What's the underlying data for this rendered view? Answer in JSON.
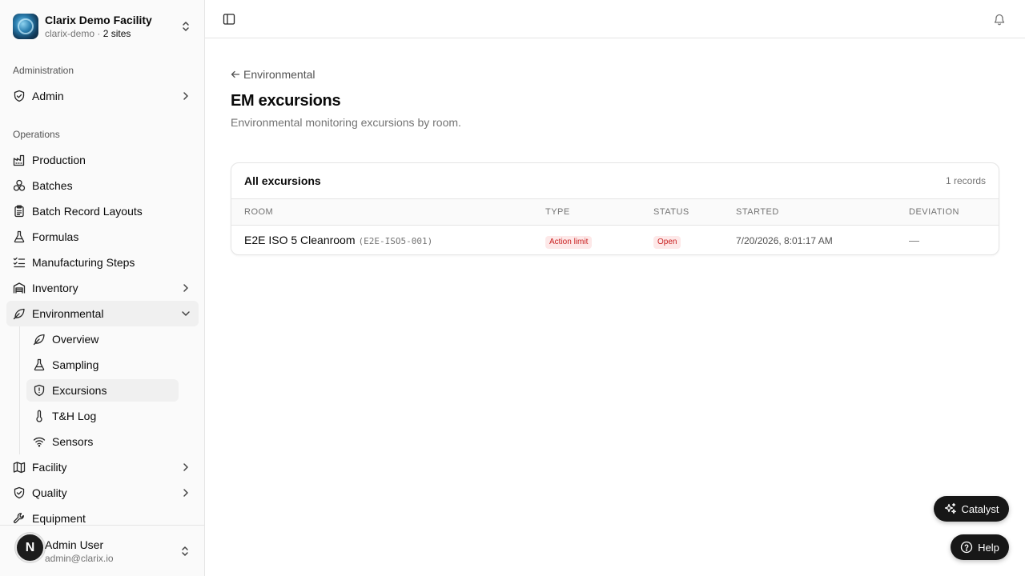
{
  "org": {
    "name": "Clarix Demo Facility",
    "slug": "clarix-demo",
    "sep": " · ",
    "sites": "2 sites"
  },
  "sidebar": {
    "section_admin": "Administration",
    "admin": "Admin",
    "section_ops": "Operations",
    "items": {
      "production": "Production",
      "batches": "Batches",
      "batch_record_layouts": "Batch Record Layouts",
      "formulas": "Formulas",
      "manufacturing_steps": "Manufacturing Steps",
      "inventory": "Inventory",
      "environmental": "Environmental",
      "facility": "Facility",
      "quality": "Quality",
      "equipment": "Equipment"
    },
    "environmental_sub": {
      "overview": "Overview",
      "sampling": "Sampling",
      "excursions": "Excursions",
      "th_log": "T&H Log",
      "sensors": "Sensors"
    }
  },
  "user": {
    "initial": "N",
    "name": "Admin User",
    "email": "admin@clarix.io"
  },
  "page": {
    "back": "Environmental",
    "title": "EM excursions",
    "description": "Environmental monitoring excursions by room."
  },
  "table": {
    "title": "All excursions",
    "count": "1 records",
    "headers": {
      "room": "ROOM",
      "type": "TYPE",
      "status": "STATUS",
      "started": "STARTED",
      "deviation": "DEVIATION"
    },
    "rows": [
      {
        "room": "E2E ISO 5 Cleanroom",
        "code": "(E2E-ISO5-001)",
        "type": "Action limit",
        "status": "Open",
        "started": "7/20/2026, 8:01:17 AM",
        "deviation": "—"
      }
    ]
  },
  "floating": {
    "catalyst": "Catalyst",
    "help": "Help"
  },
  "colors": {
    "badge_bg": "#fde8e8",
    "badge_fg": "#c81e1e",
    "fab_bg": "#171717"
  }
}
